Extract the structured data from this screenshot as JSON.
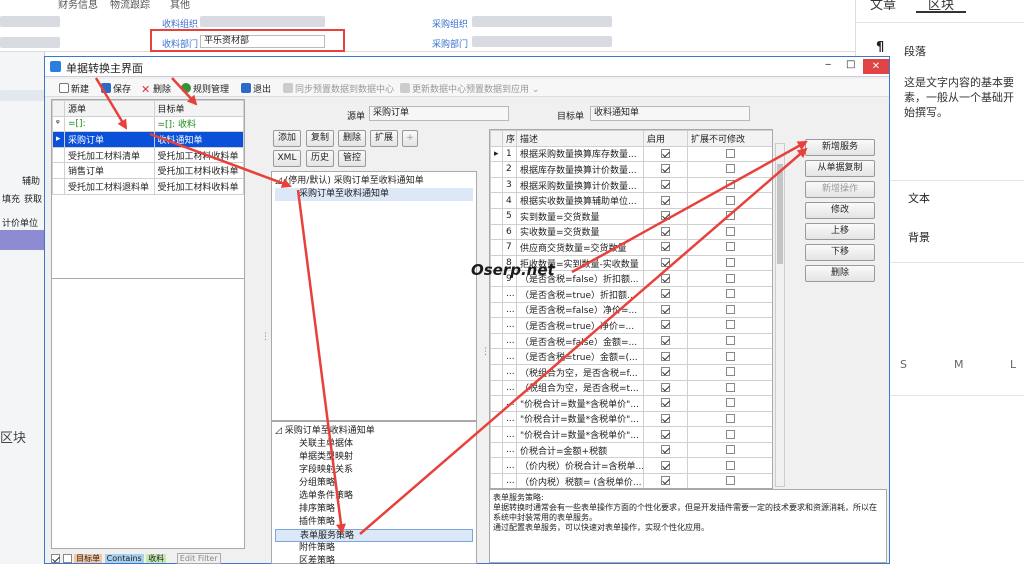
{
  "background": {
    "tabs": [
      "财务信息",
      "物流跟踪",
      "其他"
    ],
    "receive_org_label": "收料组织",
    "receive_dept_label": "收料部门",
    "receive_dept_value": "平乐资材部",
    "purchase_org_label": "采购组织",
    "purchase_dept_label": "采购部门",
    "side_labels": [
      "辅助",
      "填充",
      "获取",
      "计价单位"
    ],
    "block_label": "区块"
  },
  "right_panel": {
    "tabs": [
      "文章",
      "区块"
    ],
    "section": "段落",
    "description": "这是文字内容的基本要素，一般从一个基础开始撰写。",
    "option_text": "文本",
    "option_background": "背景",
    "sizes": [
      "S",
      "M",
      "L"
    ],
    "pilcrow": "¶"
  },
  "dialog": {
    "title": "单据转换主界面",
    "window_controls": [
      "‒",
      "□",
      "✕"
    ],
    "toolbar": {
      "new": "新建",
      "save": "保存",
      "delete": "删除",
      "rules": "规则管理",
      "exit": "退出",
      "sync": "同步预置数据到数据中心",
      "update": "更新数据中心预置数据到应用"
    },
    "source_table": {
      "headers": [
        "源单",
        "目标单"
      ],
      "filter_row": [
        "=[]:",
        "=[]: 收料"
      ],
      "rows": [
        [
          "采购订单",
          "收料通知单"
        ],
        [
          "受托加工材料清单",
          "受托加工材料收料单"
        ],
        [
          "销售订单",
          "受托加工材料收料单"
        ],
        [
          "受托加工材料退料单",
          "受托加工材料收料单"
        ]
      ]
    },
    "middle": {
      "source_label": "源单",
      "source_value": "采购订单",
      "target_label": "目标单",
      "target_value": "收料通知单",
      "buttons": [
        "添加",
        "复制",
        "删除",
        "扩展",
        "+"
      ],
      "buttons2": [
        "XML",
        "历史",
        "管控"
      ],
      "tree1": [
        "(停用/默认) 采购订单至收料通知单",
        "采购订单至收料通知单"
      ],
      "tree2_root": "采购订单至收料通知单",
      "tree2_items": [
        "关联主单据体",
        "单据类型映射",
        "字段映射关系",
        "分组策略",
        "选单条件策略",
        "排序策略",
        "插件策略",
        "表单服务策略",
        "附件策略",
        "区差策略"
      ]
    },
    "service_table": {
      "headers": [
        "序",
        "描述",
        "启用",
        "扩展不可修改"
      ],
      "rows": [
        [
          "1",
          "根据采购数量换算库存数量...",
          true
        ],
        [
          "2",
          "根据库存数量换算计价数量...",
          true
        ],
        [
          "3",
          "根据采购数量换算计价数量...",
          true
        ],
        [
          "4",
          "根据实收数量换算辅助单位...",
          true
        ],
        [
          "5",
          "实到数量=交货数量",
          true
        ],
        [
          "6",
          "实收数量=交货数量",
          true
        ],
        [
          "7",
          "供应商交货数量=交货数量",
          true
        ],
        [
          "8",
          "拒收数量=实到数量-实收数量",
          true
        ],
        [
          "9",
          "（是否含税=false）折扣额...",
          true
        ],
        [
          "...",
          "（是否含税=true）折扣额...",
          true
        ],
        [
          "...",
          "（是否含税=false）净价=...",
          true
        ],
        [
          "...",
          "（是否含税=true）净价=...",
          true
        ],
        [
          "...",
          "（是否含税=false）金额=...",
          true
        ],
        [
          "...",
          "（是否含税=true）金额=(...",
          true
        ],
        [
          "...",
          "（税组合为空，是否含税=f...",
          true
        ],
        [
          "...",
          "（税组合为空，是否含税=t...",
          true
        ],
        [
          "...",
          "\"价税合计=数量*含税单价\"...",
          true
        ],
        [
          "...",
          "\"价税合计=数量*含税单价\"...",
          true
        ],
        [
          "...",
          "\"价税合计=数量*含税单价\"...",
          true
        ],
        [
          "...",
          "价税合计=金额+税额",
          true
        ],
        [
          "...",
          "（价内税）价税合计=含税单...",
          true
        ],
        [
          "...",
          "（价内税）税额= (含税单价...",
          true
        ]
      ]
    },
    "right_buttons": [
      "新增服务",
      "从单据复制",
      "新增操作",
      "修改",
      "上移",
      "下移",
      "删除"
    ],
    "description_text": "表单服务策略:\n单据转换时通常会有一些表单操作方面的个性化要求，但是开发插件需要一定的技术要求和资源消耗，所以在系统中封装常用的表单服务。\n通过配置表单服务，可以快速对表单操作，实现个性化应用。",
    "bottom_tags": [
      "目标单",
      "Contains",
      "收料"
    ],
    "bottom_button": "Edit Filter",
    "watermark": "Oserp.net"
  },
  "colors": {
    "selection": "#0a50d8",
    "arrow": "#e8413c",
    "dialog_border": "#3c78c8"
  }
}
